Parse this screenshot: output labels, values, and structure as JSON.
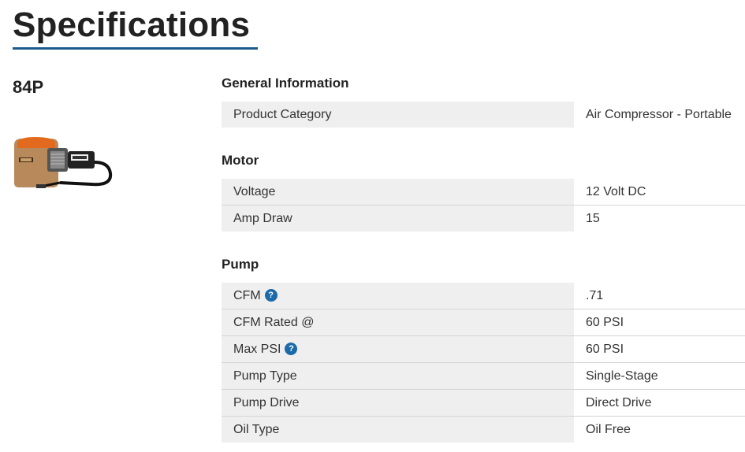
{
  "page": {
    "title": "Specifications"
  },
  "product": {
    "model": "84P"
  },
  "sections": [
    {
      "title": "General Information",
      "rows": [
        {
          "label": "Product Category",
          "value": "Air Compressor - Portable"
        }
      ]
    },
    {
      "title": "Motor",
      "rows": [
        {
          "label": "Voltage",
          "value": "12 Volt DC"
        },
        {
          "label": "Amp Draw",
          "value": "15"
        }
      ]
    },
    {
      "title": "Pump",
      "rows": [
        {
          "label": "CFM",
          "value": ".71",
          "help": "?"
        },
        {
          "label": "CFM Rated @",
          "value": "60 PSI"
        },
        {
          "label": "Max PSI",
          "value": "60 PSI",
          "help": "?"
        },
        {
          "label": "Pump Type",
          "value": "Single-Stage"
        },
        {
          "label": "Pump Drive",
          "value": "Direct Drive"
        },
        {
          "label": "Oil Type",
          "value": "Oil Free"
        }
      ]
    }
  ],
  "colors": {
    "accent": "#1c5a8c",
    "row_bg": "#efefef",
    "help_icon": "#1c6aa8"
  }
}
